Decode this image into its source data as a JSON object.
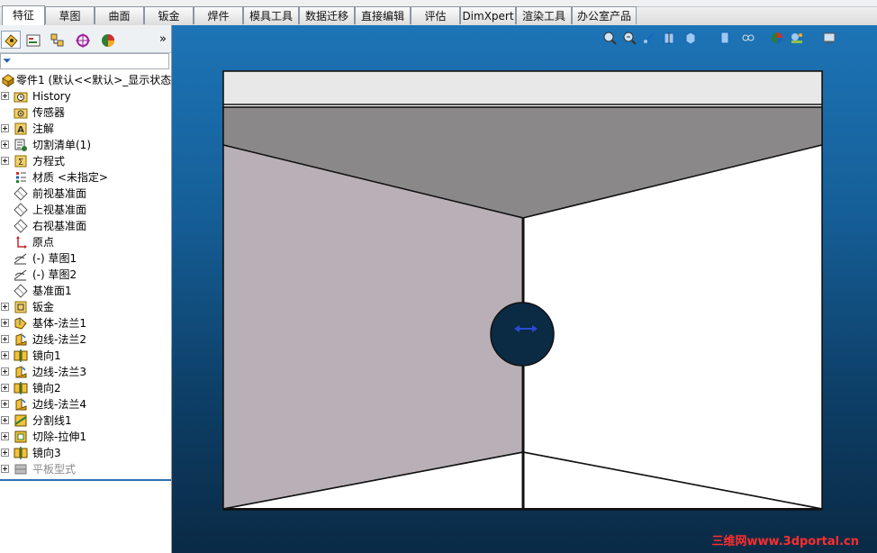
{
  "tabs": [
    {
      "label": "特征",
      "active": true
    },
    {
      "label": "草图"
    },
    {
      "label": "曲面"
    },
    {
      "label": "钣金"
    },
    {
      "label": "焊件"
    },
    {
      "label": "模具工具"
    },
    {
      "label": "数据迁移"
    },
    {
      "label": "直接编辑"
    },
    {
      "label": "评估"
    },
    {
      "label": "DimXpert"
    },
    {
      "label": "渲染工具"
    },
    {
      "label": "办公室产品"
    }
  ],
  "panel": {
    "tab_icons": [
      "feature-manager-icon",
      "property-manager-icon",
      "configuration-manager-icon",
      "dimxpert-manager-icon",
      "display-manager-icon"
    ],
    "expand_glyph": "»",
    "filter_icon": "filter-icon"
  },
  "tree": {
    "root": "零件1 (默认<<默认>_显示状态",
    "items": [
      {
        "label": "History",
        "icon": "history-folder-icon",
        "expandable": true
      },
      {
        "label": "传感器",
        "icon": "sensor-icon",
        "expandable": false
      },
      {
        "label": "注解",
        "icon": "annotation-icon",
        "expandable": true
      },
      {
        "label": "切割清单(1)",
        "icon": "cut-list-icon",
        "expandable": true
      },
      {
        "label": "方程式",
        "icon": "equation-icon",
        "expandable": true
      },
      {
        "label": "材质 <未指定>",
        "icon": "material-icon",
        "expandable": false
      },
      {
        "label": "前视基准面",
        "icon": "plane-icon",
        "expandable": false
      },
      {
        "label": "上视基准面",
        "icon": "plane-icon",
        "expandable": false
      },
      {
        "label": "右视基准面",
        "icon": "plane-icon",
        "expandable": false
      },
      {
        "label": "原点",
        "icon": "origin-icon",
        "expandable": false
      },
      {
        "label": "(-) 草图1",
        "icon": "sketch-icon",
        "expandable": false
      },
      {
        "label": "(-) 草图2",
        "icon": "sketch-icon",
        "expandable": false
      },
      {
        "label": "基准面1",
        "icon": "plane-icon",
        "expandable": false
      },
      {
        "label": "钣金",
        "icon": "sheet-metal-icon",
        "expandable": true
      },
      {
        "label": "基体-法兰1",
        "icon": "base-flange-icon",
        "expandable": true
      },
      {
        "label": "边线-法兰2",
        "icon": "edge-flange-icon",
        "expandable": true
      },
      {
        "label": "镜向1",
        "icon": "mirror-icon",
        "expandable": true
      },
      {
        "label": "边线-法兰3",
        "icon": "edge-flange-icon",
        "expandable": true
      },
      {
        "label": "镜向2",
        "icon": "mirror-icon",
        "expandable": true
      },
      {
        "label": "边线-法兰4",
        "icon": "edge-flange-icon",
        "expandable": true
      },
      {
        "label": "分割线1",
        "icon": "split-line-icon",
        "expandable": true
      },
      {
        "label": "切除-拉伸1",
        "icon": "cut-extrude-icon",
        "expandable": true
      },
      {
        "label": "镜向3",
        "icon": "mirror-icon",
        "expandable": true
      },
      {
        "label": "平板型式",
        "icon": "flat-pattern-icon",
        "expandable": true,
        "suppressed": true
      }
    ]
  },
  "view_toolbar": [
    "zoom-to-fit-icon",
    "zoom-area-icon",
    "previous-view-icon",
    "section-view-icon",
    "view-orientation-icon",
    "display-style-icon",
    "hide-show-icon",
    "appearance-icon",
    "scene-icon",
    "view-settings-icon"
  ],
  "watermark": "三维网www.3dportal.cn",
  "colors": {
    "accent": "#2f6fb4",
    "background_top": "#1d74b6",
    "background_bottom": "#0a2a45"
  }
}
